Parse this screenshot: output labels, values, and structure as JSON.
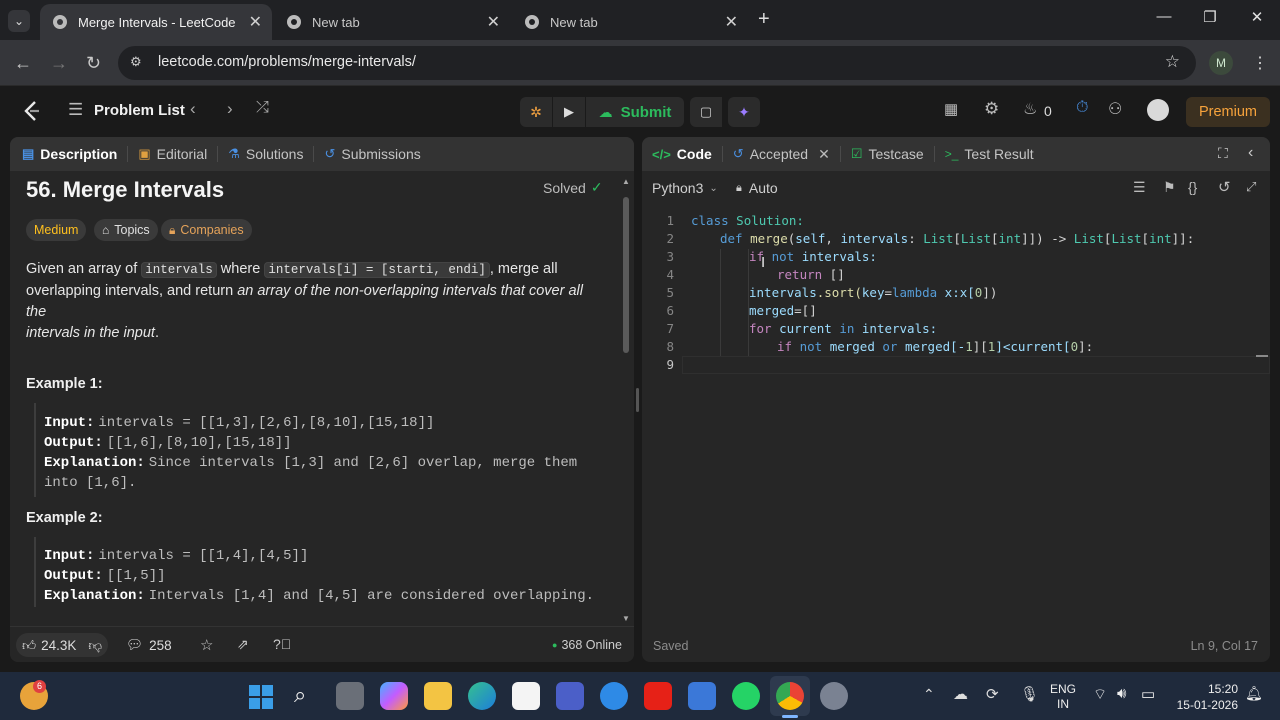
{
  "browser": {
    "tabs": [
      {
        "title": "Merge Intervals - LeetCode",
        "active": true
      },
      {
        "title": "New tab",
        "active": false
      },
      {
        "title": "New tab",
        "active": false
      }
    ],
    "url": "leetcode.com/problems/merge-intervals/",
    "profile_initial": "M"
  },
  "header": {
    "problem_list": "Problem List",
    "submit": "Submit",
    "streak": "0",
    "premium": "Premium"
  },
  "left_panel": {
    "tabs": [
      "Description",
      "Editorial",
      "Solutions",
      "Submissions"
    ],
    "title": "56. Merge Intervals",
    "status": "Solved",
    "tags": {
      "difficulty": "Medium",
      "topics": "Topics",
      "companies": "Companies"
    },
    "desc": {
      "p1": "Given an array of ",
      "code1": "intervals",
      "p2": " where ",
      "code2": "intervals[i] = [starti, endi]",
      "p3": ", merge all",
      "p4": "overlapping intervals, and return ",
      "p5": "an array of the non-overlapping intervals that cover all the",
      "p6": "intervals in the input",
      "p7": "."
    },
    "example1": {
      "heading": "Example 1:",
      "input_label": "Input:",
      "input": "intervals = [[1,3],[2,6],[8,10],[15,18]]",
      "output_label": "Output:",
      "output": "[[1,6],[8,10],[15,18]]",
      "expl_label": "Explanation:",
      "expl1": "Since intervals [1,3] and [2,6] overlap, merge them",
      "expl2": "into [1,6]."
    },
    "example2": {
      "heading": "Example 2:",
      "input_label": "Input:",
      "input": "intervals = [[1,4],[4,5]]",
      "output_label": "Output:",
      "output": "[[1,5]]",
      "expl_label": "Explanation:",
      "expl1": "Intervals [1,4] and [4,5] are considered overlapping."
    },
    "footer": {
      "likes": "24.3K",
      "comments": "258",
      "online": "368 Online"
    }
  },
  "right_panel": {
    "tabs": [
      "Code",
      "Accepted",
      "Testcase",
      "Test Result"
    ],
    "language": "Python3",
    "mode": "Auto",
    "code": {
      "l1a": "class",
      "l1b": " Solution:",
      "l2a": "def",
      "l2b": "merge",
      "l2c": "(",
      "l2d": "self",
      "l2e": ", ",
      "l2f": "intervals",
      "l2g": ": ",
      "l2h": "List",
      "l2i": "[",
      "l2j": "List",
      "l2k": "[",
      "l2l": "int",
      "l2m": "]]) -> ",
      "l2n": "List",
      "l2o": "[",
      "l2p": "List",
      "l2q": "[",
      "l2r": "int",
      "l2s": "]]:",
      "l3a": "if",
      "l3b": "not",
      "l3c": " intervals:",
      "l4a": "return",
      "l4b": " []",
      "l5a": "intervals",
      "l5b": ".sort(",
      "l5c": "key",
      "l5d": "=",
      "l5e": "lambda",
      "l5f": " x:x[",
      "l5g": "0",
      "l5h": "])",
      "l6a": "merged",
      "l6b": "=[]",
      "l7a": "for",
      "l7b": " current ",
      "l7c": "in",
      "l7d": " intervals:",
      "l8a": "if",
      "l8b": "not",
      "l8c": " merged ",
      "l8d": "or",
      "l8e": " merged[-",
      "l8f": "1",
      "l8g": "][",
      "l8h": "1",
      "l8i": "]<current[",
      "l8j": "0",
      "l8k": "]:"
    },
    "line_numbers": [
      "1",
      "2",
      "3",
      "4",
      "5",
      "6",
      "7",
      "8",
      "9"
    ],
    "status_left": "Saved",
    "status_right": "Ln 9, Col 17"
  },
  "taskbar": {
    "badge": "6",
    "lang1": "ENG",
    "lang2": "IN",
    "time": "15:20",
    "date": "15-01-2026"
  }
}
